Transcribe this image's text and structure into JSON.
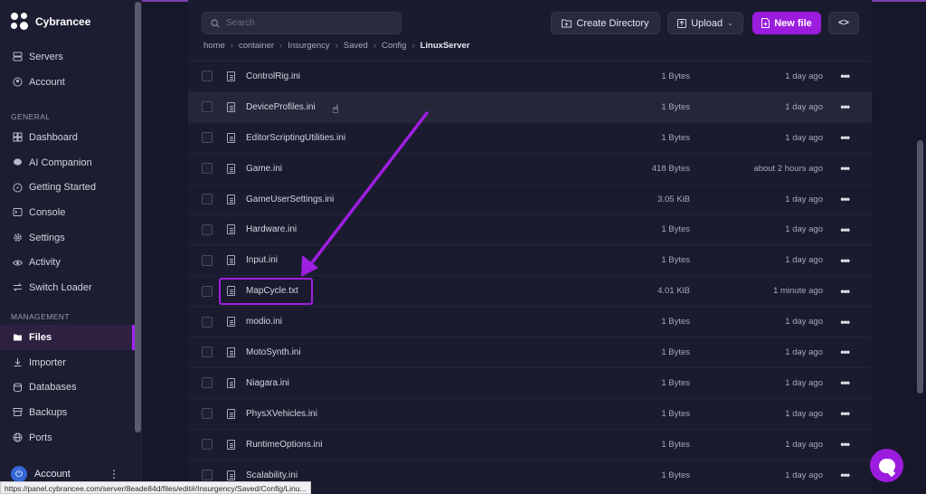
{
  "brand": {
    "name": "Cybrancee"
  },
  "sidebar": {
    "top_items": [
      {
        "label": "Servers",
        "icon": "server-icon"
      },
      {
        "label": "Account",
        "icon": "account-icon"
      }
    ],
    "sections": [
      {
        "label": "GENERAL",
        "items": [
          {
            "label": "Dashboard",
            "icon": "dashboard-icon"
          },
          {
            "label": "AI Companion",
            "icon": "chat-icon"
          },
          {
            "label": "Getting Started",
            "icon": "compass-icon"
          },
          {
            "label": "Console",
            "icon": "terminal-icon"
          },
          {
            "label": "Settings",
            "icon": "gear-icon"
          },
          {
            "label": "Activity",
            "icon": "eye-icon"
          },
          {
            "label": "Switch Loader",
            "icon": "swap-icon"
          }
        ]
      },
      {
        "label": "MANAGEMENT",
        "items": [
          {
            "label": "Files",
            "icon": "folder-icon",
            "active": true
          },
          {
            "label": "Importer",
            "icon": "download-icon"
          },
          {
            "label": "Databases",
            "icon": "database-icon"
          },
          {
            "label": "Backups",
            "icon": "archive-icon"
          },
          {
            "label": "Ports",
            "icon": "globe-icon"
          }
        ]
      }
    ],
    "bottom_account": "Account"
  },
  "toolbar": {
    "search_placeholder": "Search",
    "create_directory": "Create Directory",
    "upload": "Upload",
    "new_file": "New file",
    "code_toggle": "<>"
  },
  "breadcrumb": [
    "home",
    "container",
    "Insurgency",
    "Saved",
    "Config",
    "LinuxServer"
  ],
  "files": [
    {
      "name": "ControlRig.ini",
      "size": "1 Bytes",
      "modified": "1 day ago"
    },
    {
      "name": "DeviceProfiles.ini",
      "size": "1 Bytes",
      "modified": "1 day ago"
    },
    {
      "name": "EditorScriptingUtilities.ini",
      "size": "1 Bytes",
      "modified": "1 day ago"
    },
    {
      "name": "Game.ini",
      "size": "418 Bytes",
      "modified": "about 2 hours ago"
    },
    {
      "name": "GameUserSettings.ini",
      "size": "3.05 KiB",
      "modified": "1 day ago"
    },
    {
      "name": "Hardware.ini",
      "size": "1 Bytes",
      "modified": "1 day ago"
    },
    {
      "name": "Input.ini",
      "size": "1 Bytes",
      "modified": "1 day ago"
    },
    {
      "name": "MapCycle.txt",
      "size": "4.01 KiB",
      "modified": "1 minute ago"
    },
    {
      "name": "modio.ini",
      "size": "1 Bytes",
      "modified": "1 day ago"
    },
    {
      "name": "MotoSynth.ini",
      "size": "1 Bytes",
      "modified": "1 day ago"
    },
    {
      "name": "Niagara.ini",
      "size": "1 Bytes",
      "modified": "1 day ago"
    },
    {
      "name": "PhysXVehicles.ini",
      "size": "1 Bytes",
      "modified": "1 day ago"
    },
    {
      "name": "RuntimeOptions.ini",
      "size": "1 Bytes",
      "modified": "1 day ago"
    },
    {
      "name": "Scalability.ini",
      "size": "1 Bytes",
      "modified": "1 day ago"
    }
  ],
  "status_url": "https://panel.cybrancee.com/server/8eade84d/files/edit#/Insurgency/Saved/Config/Linu...",
  "colors": {
    "accent": "#9b1cde",
    "background": "#17172a",
    "panel": "#1b1b2f"
  }
}
